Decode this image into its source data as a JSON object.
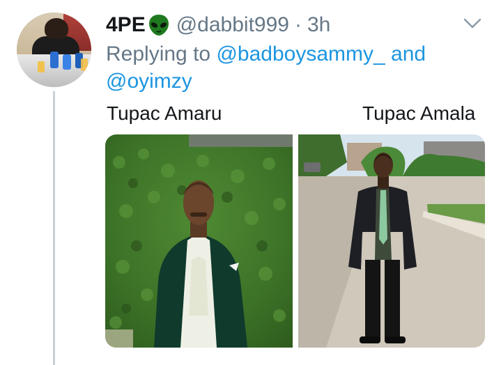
{
  "tweet": {
    "display_name": "4PE",
    "name_emoji_icon": "alien-face-icon",
    "handle": "@dabbit999",
    "separator": "·",
    "time": "3h",
    "menu_icon": "chevron-down-icon",
    "replying_prefix": "Replying to",
    "mention_1": "@badboysammy_",
    "conjunction": "and",
    "mention_2": "@oyimzy",
    "captions": {
      "left": "Tupac Amaru",
      "right": "Tupac Amala"
    },
    "colors": {
      "link": "#1b95e0",
      "secondary_text": "#657786",
      "primary_text": "#14171a",
      "thread_line": "#c8d0d6"
    }
  }
}
